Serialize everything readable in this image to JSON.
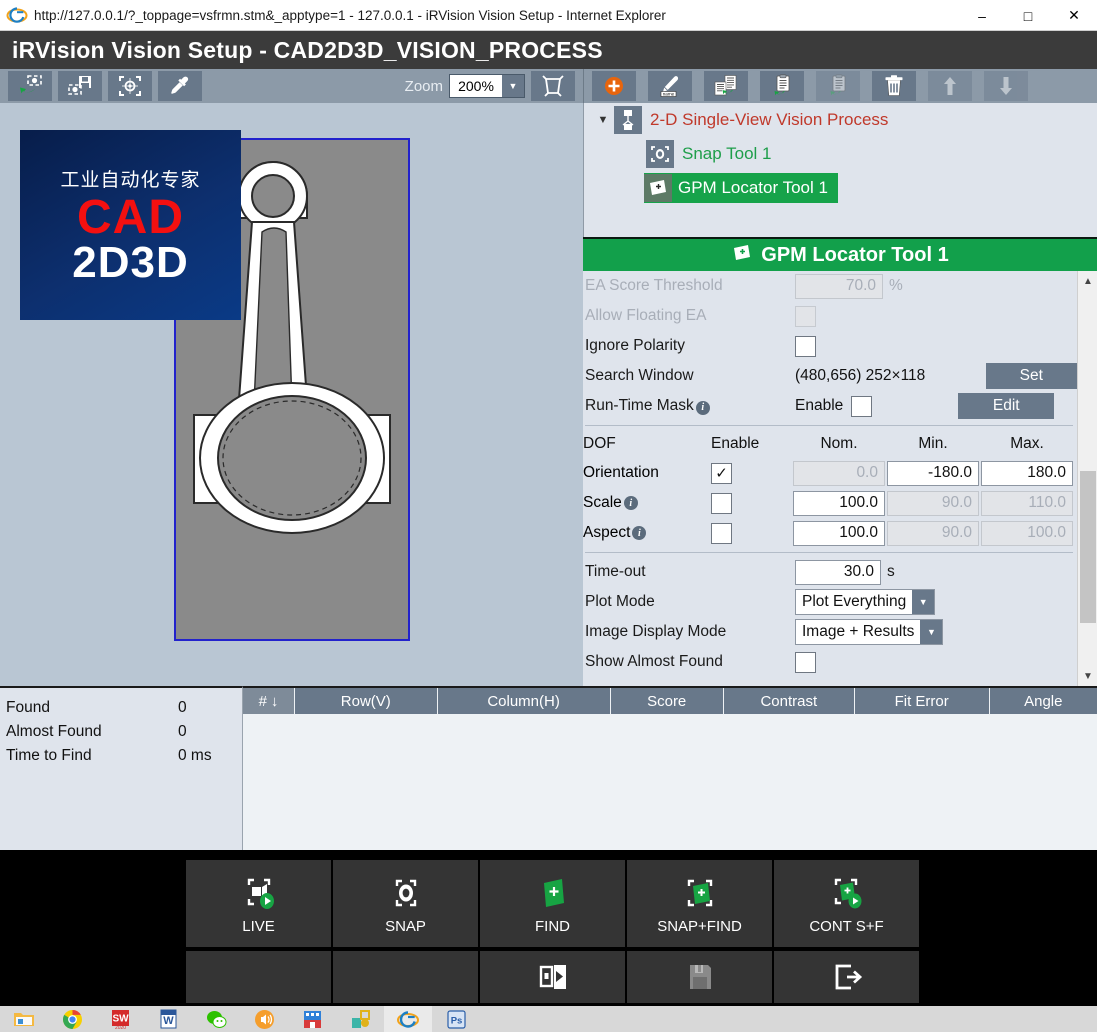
{
  "browser": {
    "title": "http://127.0.0.1/?_toppage=vsfrmn.stm&_apptype=1 - 127.0.0.1 - iRVision Vision Setup - Internet Explorer",
    "minimize": "–",
    "maximize": "□",
    "close": "✕"
  },
  "app": {
    "header_title": "iRVision Vision Setup - CAD2D3D_VISION_PROCESS"
  },
  "toolbar_left": {
    "buttons": [
      {
        "name": "load-image-icon",
        "title": "Load Image"
      },
      {
        "name": "save-image-icon",
        "title": "Save Image"
      },
      {
        "name": "center-target-icon",
        "title": "Center"
      },
      {
        "name": "eyedropper-icon",
        "title": "Pick Color"
      }
    ],
    "zoom_label": "Zoom",
    "zoom_value": "200%",
    "zoom_arrow": "▼",
    "fit_button": "fit-to-window-icon"
  },
  "toolbar_right": {
    "buttons": [
      {
        "name": "add-tool-icon",
        "title": "Add",
        "disabled": false
      },
      {
        "name": "rename-tool-icon",
        "title": "Rename",
        "disabled": false
      },
      {
        "name": "copy-tool-icon",
        "title": "Copy",
        "disabled": false
      },
      {
        "name": "paste-tool-icon",
        "title": "Paste",
        "disabled": false
      },
      {
        "name": "paste-special-icon",
        "title": "Paste Special",
        "disabled": true
      },
      {
        "name": "delete-tool-icon",
        "title": "Delete",
        "disabled": false
      },
      {
        "name": "move-up-icon",
        "title": "Move Up",
        "disabled": true
      },
      {
        "name": "move-down-icon",
        "title": "Move Down",
        "disabled": true
      }
    ]
  },
  "viewport": {
    "watermark": {
      "cn_text": "工业自动化专家",
      "cad_text": "CAD",
      "dim_text": "2D3D"
    },
    "image_alt": "connecting-rod-outline"
  },
  "tree": {
    "caret": "▼",
    "root": {
      "label": "2-D Single-View Vision Process",
      "icon": "vision-process-icon"
    },
    "children": [
      {
        "label": "Snap Tool 1",
        "icon": "camera-icon",
        "selected": false
      },
      {
        "label": "GPM Locator Tool 1",
        "icon": "gpm-locator-icon",
        "selected": true
      }
    ]
  },
  "section": {
    "title": "GPM Locator Tool 1",
    "icon": "gpm-locator-icon"
  },
  "properties": {
    "rows": [
      {
        "label": "EA Score Threshold",
        "value": "70.0",
        "unit": "%",
        "disabled": true
      },
      {
        "label": "Allow Floating EA",
        "checkbox": false,
        "disabled": true
      },
      {
        "label": "Ignore Polarity",
        "checkbox": false,
        "disabled": false
      }
    ],
    "search_window": {
      "label": "Search Window",
      "value": "(480,656) 252×118",
      "button": "Set"
    },
    "runtime_mask": {
      "label": "Run-Time Mask",
      "enable_label": "Enable",
      "enabled": false,
      "button": "Edit"
    },
    "dof": {
      "headers": [
        "DOF",
        "Enable",
        "Nom.",
        "Min.",
        "Max."
      ],
      "rows": [
        {
          "name": "Orientation",
          "has_info": false,
          "enabled": true,
          "nom": "0.0",
          "nom_dis": true,
          "min": "-180.0",
          "min_dis": false,
          "max": "180.0",
          "max_dis": false,
          "unit": "°"
        },
        {
          "name": "Scale",
          "has_info": true,
          "enabled": false,
          "nom": "100.0",
          "nom_dis": false,
          "min": "90.0",
          "min_dis": true,
          "max": "110.0",
          "max_dis": true,
          "unit": "%"
        },
        {
          "name": "Aspect",
          "has_info": true,
          "enabled": false,
          "nom": "100.0",
          "nom_dis": false,
          "min": "90.0",
          "min_dis": true,
          "max": "100.0",
          "max_dis": true,
          "unit": "%"
        }
      ]
    },
    "timeout": {
      "label": "Time-out",
      "value": "30.0",
      "unit": "s"
    },
    "plot_mode": {
      "label": "Plot Mode",
      "value": "Plot Everything",
      "arrow": "▼"
    },
    "image_display_mode": {
      "label": "Image Display Mode",
      "value": "Image + Results",
      "arrow": "▼"
    },
    "show_almost_found": {
      "label": "Show Almost Found",
      "checked": false
    }
  },
  "results": {
    "summary": [
      {
        "key": "Found",
        "value": "0"
      },
      {
        "key": "Almost Found",
        "value": "0"
      },
      {
        "key": "Time to Find",
        "value": "0 ms"
      }
    ],
    "table": {
      "columns": [
        "#",
        "Row(V)",
        "Column(H)",
        "Score",
        "Contrast",
        "Fit Error",
        "Angle"
      ],
      "sort_arrow": "↓",
      "rows": []
    }
  },
  "action_bar": {
    "row1": [
      {
        "label": "LIVE",
        "icon": "live-camera-icon"
      },
      {
        "label": "SNAP",
        "icon": "snap-camera-icon"
      },
      {
        "label": "FIND",
        "icon": "find-plus-icon"
      },
      {
        "label": "SNAP+FIND",
        "icon": "snap-find-icon"
      },
      {
        "label": "CONT S+F",
        "icon": "continuous-snap-find-icon"
      }
    ],
    "row2": [
      {
        "label": "",
        "icon": ""
      },
      {
        "label": "",
        "icon": ""
      },
      {
        "label": "",
        "icon": "run-icon"
      },
      {
        "label": "",
        "icon": "save-disk-icon"
      },
      {
        "label": "",
        "icon": "exit-icon"
      }
    ]
  },
  "taskbar": {
    "items": [
      {
        "name": "file-explorer-icon"
      },
      {
        "name": "chrome-icon"
      },
      {
        "name": "solidworks-icon"
      },
      {
        "name": "word-icon"
      },
      {
        "name": "wechat-icon"
      },
      {
        "name": "volume-app-icon"
      },
      {
        "name": "video-app-icon"
      },
      {
        "name": "security-app-icon"
      },
      {
        "name": "internet-explorer-icon"
      },
      {
        "name": "photoshop-icon"
      }
    ]
  },
  "colors": {
    "app_header_bg": "#3b3b3b",
    "toolbar_bg": "#8c9aa8",
    "accent_green": "#12a04b",
    "panel_bg": "#dfe4ec",
    "viewport_bg": "#b9c6d3",
    "tree_red": "#c0392b",
    "tree_green": "#1e9e4a",
    "watermark_red": "#f41010",
    "action_bar_bg": "#000000"
  }
}
